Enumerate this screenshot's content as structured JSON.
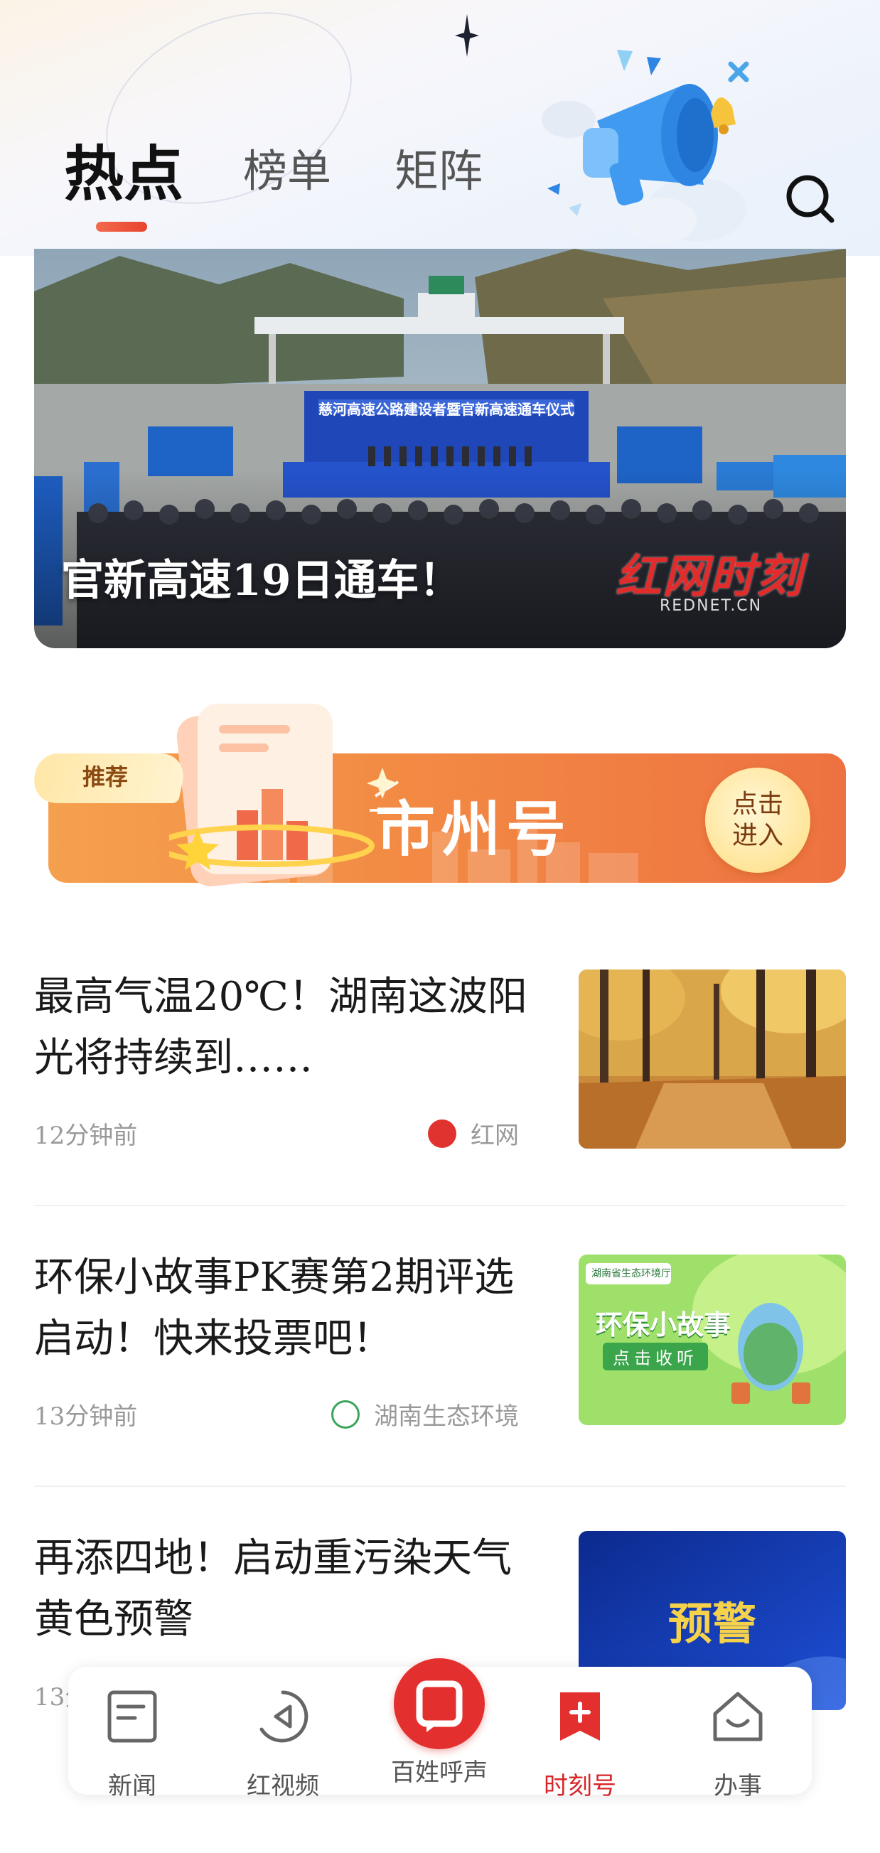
{
  "header": {
    "tabs": [
      {
        "label": "热点",
        "active": true
      },
      {
        "label": "榜单",
        "active": false
      },
      {
        "label": "矩阵",
        "active": false
      }
    ]
  },
  "hero": {
    "caption": "官新高速19日通车！",
    "logo_text": "红网时刻",
    "logo_sub": "REDNET.CN",
    "sign_text": "慈河高速公路建设者暨官新高速通车仪式"
  },
  "banner": {
    "tag": "推荐",
    "title": "市州号",
    "button": "点击进入"
  },
  "news": [
    {
      "title": "最高气温20℃！湖南这波阳光将持续到……",
      "time": "12分钟前",
      "source": "红网"
    },
    {
      "title": "环保小故事PK赛第2期评选启动！快来投票吧！",
      "time": "13分钟前",
      "source": "湖南生态环境",
      "thumb_badge": "湖南省生态环境厅",
      "thumb_title": "环保小故事",
      "thumb_sub": "点击收听"
    },
    {
      "title": "再添四地！启动重污染天气黄色预警",
      "time": "13分钟前",
      "thumb_title": "预警"
    }
  ],
  "bottom_nav": {
    "items": [
      {
        "label": "新闻",
        "icon": "news-icon"
      },
      {
        "label": "红视频",
        "icon": "video-icon"
      },
      {
        "label": "百姓呼声",
        "icon": "voice-icon"
      },
      {
        "label": "时刻号",
        "icon": "bookmark-plus-icon",
        "active": true
      },
      {
        "label": "办事",
        "icon": "service-icon"
      }
    ]
  },
  "colors": {
    "accent": "#e3302f",
    "banner_orange": "#f28a44",
    "active_nav": "#d6262a"
  }
}
